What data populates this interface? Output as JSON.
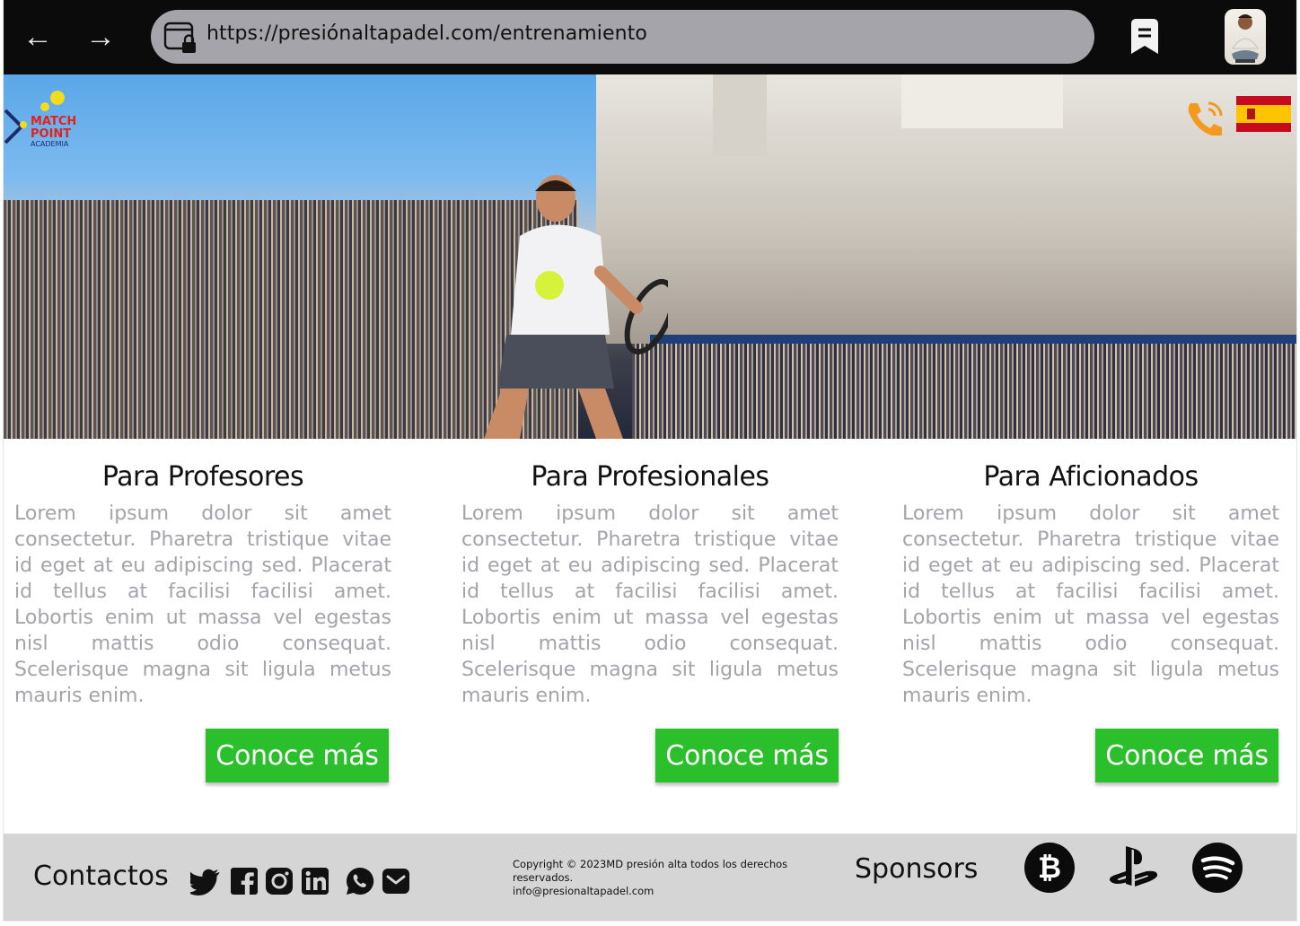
{
  "browser": {
    "back_glyph": "←",
    "forward_glyph": "→",
    "url": "https://presiónaltapadel.com/entrenamiento",
    "icons": [
      "back-arrow-icon",
      "forward-arrow-icon",
      "site-lock-icon",
      "bookmark-icon",
      "avatar"
    ]
  },
  "hero": {
    "logo_lines": [
      "MATCH",
      "POINT",
      "ACADEMIA"
    ],
    "icons": [
      "phone-icon",
      "spain-flag-icon"
    ]
  },
  "cards": [
    {
      "title": "Para Profesores",
      "body": "Lorem ipsum dolor sit amet consectetur. Pharetra tristique vitae id eget at eu adipiscing sed. Placerat id tellus at facilisi facilisi amet. Lobortis enim ut massa vel egestas nisl mattis odio consequat. Scelerisque magna sit ligula metus mauris enim.",
      "button": "Conoce más"
    },
    {
      "title": "Para Profesionales",
      "body": "Lorem ipsum dolor sit amet consectetur. Pharetra tristique vitae id eget at eu adipiscing sed. Placerat id tellus at facilisi facilisi amet. Lobortis enim ut massa vel egestas nisl mattis odio consequat. Scelerisque magna sit ligula metus mauris enim.",
      "button": "Conoce más"
    },
    {
      "title": "Para Aficionados",
      "body": "Lorem ipsum dolor sit amet consectetur. Pharetra tristique vitae id eget at eu adipiscing sed. Placerat id tellus at facilisi facilisi amet. Lobortis enim ut massa vel egestas nisl mattis odio consequat. Scelerisque magna sit ligula metus mauris enim.",
      "button": "Conoce más"
    }
  ],
  "footer": {
    "contacts_label": "Contactos",
    "social_icons": [
      "twitter-icon",
      "facebook-icon",
      "instagram-icon",
      "linkedin-icon",
      "whatsapp-icon",
      "email-icon"
    ],
    "copyright": "Copyright © 2023MD presión alta todos los derechos reservados.",
    "email": "info@presionaltapadel.com",
    "sponsors_label": "Sponsors",
    "sponsor_icons": [
      "bitcoin-icon",
      "playstation-icon",
      "spotify-icon"
    ]
  },
  "colors": {
    "topbar": "#0b0b0b",
    "urlbar": "#a5a4ab",
    "cta_green": "#2bc02b",
    "body_text_gray": "#a3a3aa",
    "footer_bg": "#d5d5d6"
  }
}
